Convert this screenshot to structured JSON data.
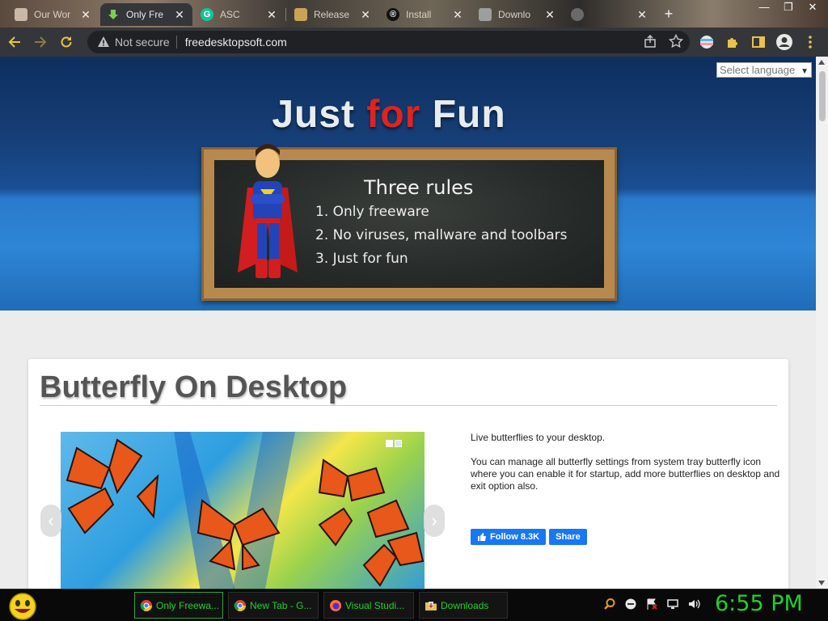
{
  "browser": {
    "tabs": [
      {
        "label": "Our Wor",
        "icon": "page-icon",
        "active": false
      },
      {
        "label": "Only Fre",
        "icon": "download-arrow-icon",
        "active": true
      },
      {
        "label": "ASC",
        "icon": "grammarly-icon",
        "active": false
      },
      {
        "label": "Release",
        "icon": "puzzle-icon",
        "active": false
      },
      {
        "label": "Install",
        "icon": "registered-icon",
        "active": false
      },
      {
        "label": "Downlo",
        "icon": "page-icon",
        "active": false
      },
      {
        "label": "",
        "icon": "page-icon",
        "active": false
      }
    ],
    "new_tab_label": "+",
    "window_buttons": [
      "—",
      "❐",
      "✕"
    ],
    "security_label": "Not secure",
    "url": "freedesktopsoft.com",
    "accent": "#e8c24a"
  },
  "page": {
    "language_select": "Select language",
    "hero": {
      "title_part1": "Just ",
      "title_part2": "for",
      "title_part3": " Fun",
      "board_heading": "Three rules",
      "rules": [
        "1. Only freeware",
        "2. No viruses, mallware and toolbars",
        "3. Just for fun"
      ]
    },
    "card": {
      "title": "Butterfly On Desktop",
      "desc_1": "Live butterflies to your desktop.",
      "desc_2": "You can manage all butterfly settings from system tray butterfly icon where you can enable it for startup, add more butterflies on desktop and exit option also.",
      "follow_label": "Follow 8.3K",
      "share_label": "Share",
      "slider_prev": "‹",
      "slider_next": "›"
    }
  },
  "taskbar": {
    "tasks": [
      {
        "label": "Only Freewa...",
        "icon": "chrome-icon",
        "active": true
      },
      {
        "label": "New Tab - G...",
        "icon": "chrome-icon",
        "active": false
      },
      {
        "label": "Visual Studi...",
        "icon": "firefox-icon",
        "active": false
      },
      {
        "label": "Downloads",
        "icon": "folder-icon",
        "active": false
      }
    ],
    "clock": "6:55 PM",
    "clock_color": "#1fd12a"
  }
}
